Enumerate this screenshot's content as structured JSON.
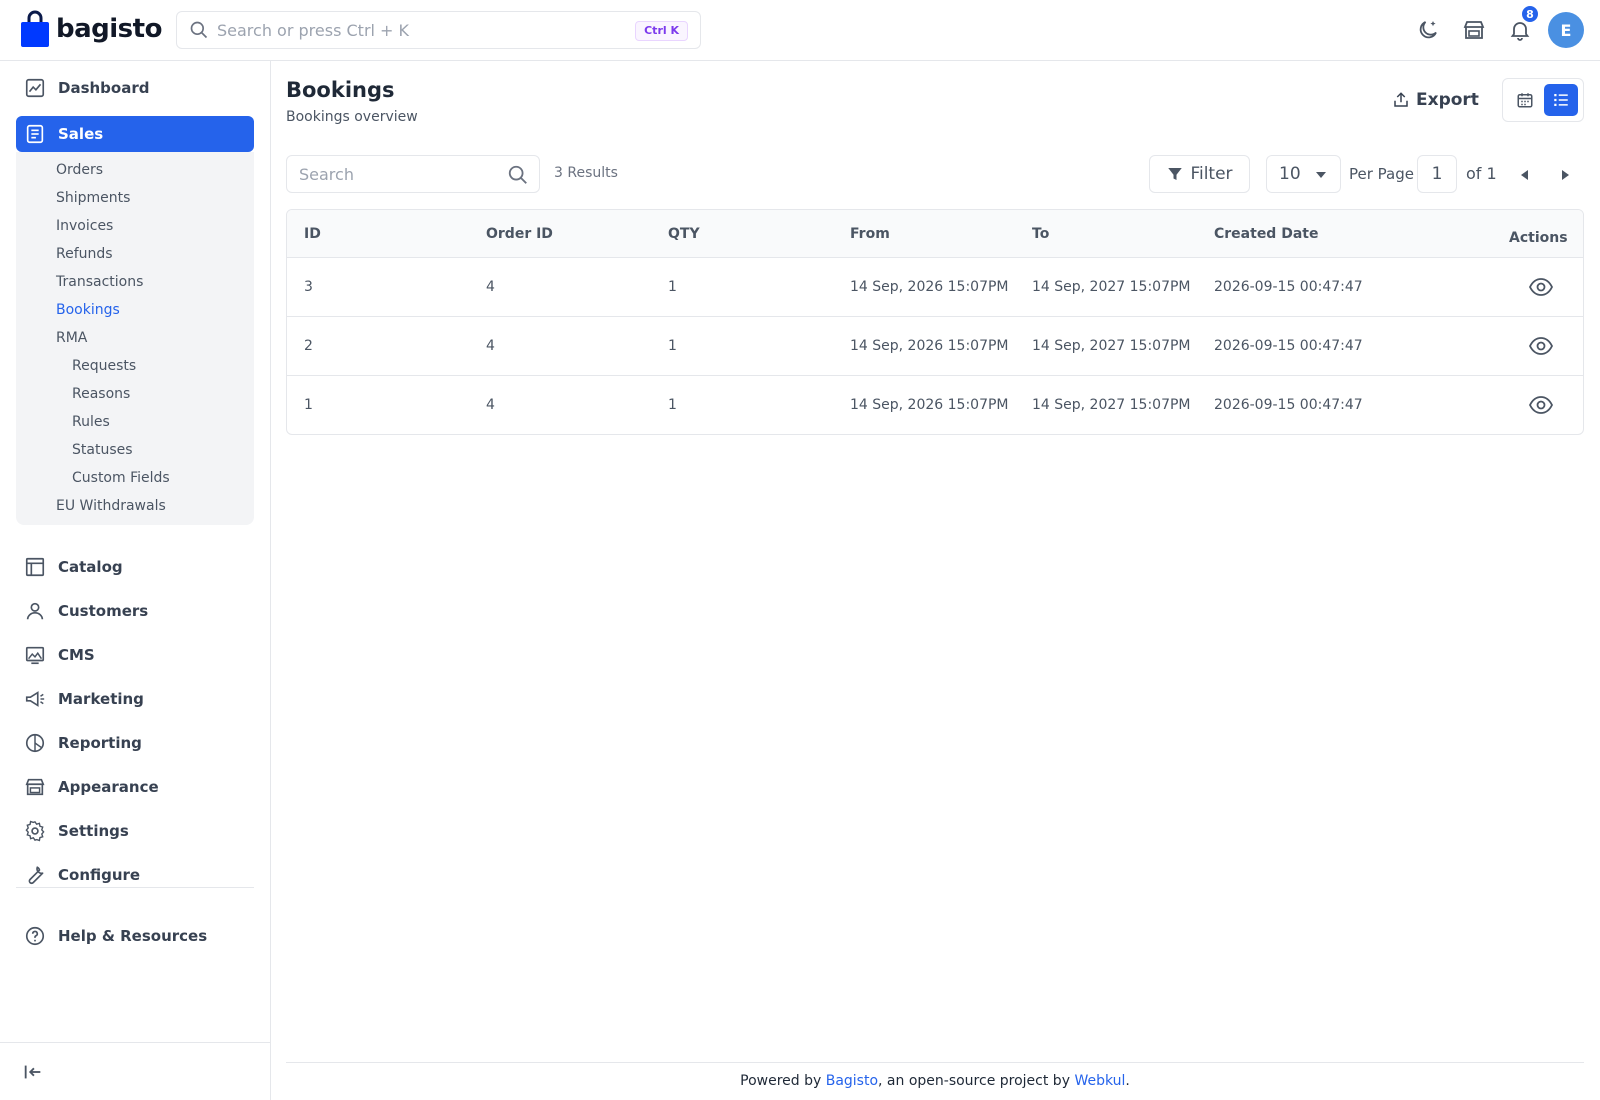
{
  "header": {
    "brand": "bagisto",
    "search_placeholder": "Search or press Ctrl + K",
    "shortcut": "Ctrl K",
    "notification_count": "8",
    "avatar_initial": "E"
  },
  "sidebar": {
    "items": [
      {
        "label": "Dashboard",
        "icon": "dashboard-icon"
      },
      {
        "label": "Sales",
        "icon": "sales-icon"
      },
      {
        "label": "Catalog",
        "icon": "catalog-icon"
      },
      {
        "label": "Customers",
        "icon": "customers-icon"
      },
      {
        "label": "CMS",
        "icon": "cms-icon"
      },
      {
        "label": "Marketing",
        "icon": "marketing-icon"
      },
      {
        "label": "Reporting",
        "icon": "reporting-icon"
      },
      {
        "label": "Appearance",
        "icon": "appearance-icon"
      },
      {
        "label": "Settings",
        "icon": "settings-icon"
      },
      {
        "label": "Configure",
        "icon": "configure-icon"
      },
      {
        "label": "Help & Resources",
        "icon": "help-icon"
      }
    ],
    "sales_sub": [
      "Orders",
      "Shipments",
      "Invoices",
      "Refunds",
      "Transactions",
      "Bookings",
      "RMA"
    ],
    "rma_sub": [
      "Requests",
      "Reasons",
      "Rules",
      "Statuses",
      "Custom Fields"
    ],
    "eu": "EU Withdrawals",
    "active_sub": "Bookings"
  },
  "page": {
    "title": "Bookings",
    "subtitle": "Bookings overview",
    "export_label": "Export"
  },
  "toolbar": {
    "search_placeholder": "Search",
    "results": "3 Results",
    "filter_label": "Filter",
    "per_page_value": "10",
    "per_page_label": "Per Page",
    "page_value": "1",
    "page_of": "of 1"
  },
  "table": {
    "columns": [
      "ID",
      "Order ID",
      "QTY",
      "From",
      "To",
      "Created Date",
      "Actions"
    ],
    "rows": [
      {
        "id": "3",
        "order_id": "4",
        "qty": "1",
        "from": "14 Sep, 2026 15:07PM",
        "to": "14 Sep, 2027 15:07PM",
        "created": "2026-09-15 00:47:47"
      },
      {
        "id": "2",
        "order_id": "4",
        "qty": "1",
        "from": "14 Sep, 2026 15:07PM",
        "to": "14 Sep, 2027 15:07PM",
        "created": "2026-09-15 00:47:47"
      },
      {
        "id": "1",
        "order_id": "4",
        "qty": "1",
        "from": "14 Sep, 2026 15:07PM",
        "to": "14 Sep, 2027 15:07PM",
        "created": "2026-09-15 00:47:47"
      }
    ]
  },
  "footer": {
    "prefix": "Powered by ",
    "link1": "Bagisto",
    "middle": ", an open-source project by ",
    "link2": "Webkul",
    "suffix": "."
  },
  "colors": {
    "accent": "#2563eb",
    "border": "#e5e7eb",
    "panel": "#f3f4f6"
  }
}
